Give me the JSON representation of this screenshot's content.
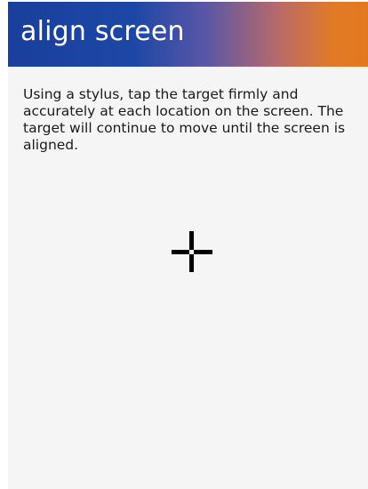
{
  "header": {
    "title": "align screen"
  },
  "instructions": {
    "text": "Using a stylus, tap the target firmly and accurately at each location on the screen. The target will continue to move until the screen is aligned."
  },
  "target": {
    "icon": "crosshair-icon"
  }
}
